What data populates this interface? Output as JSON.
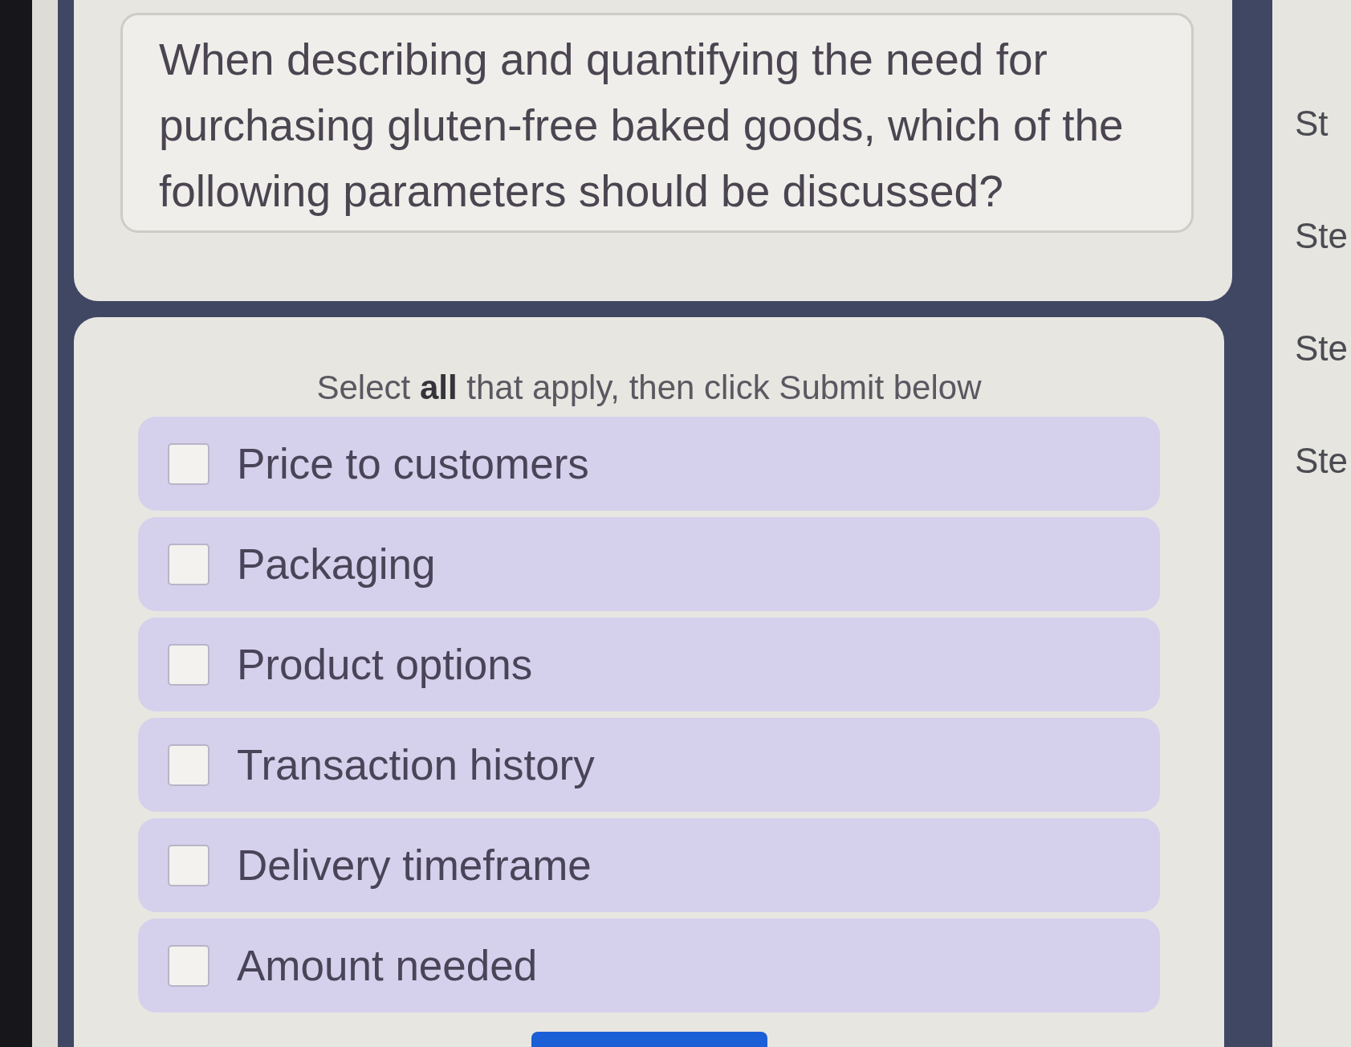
{
  "question": {
    "text": "When describing and quantifying the need for purchasing gluten-free baked goods, which of the following parameters should be discussed?"
  },
  "instructions": "Select **all** that apply, then click Submit below",
  "options": [
    {
      "label": "Price to customers",
      "checked": false
    },
    {
      "label": "Packaging",
      "checked": false
    },
    {
      "label": "Product options",
      "checked": false
    },
    {
      "label": "Transaction history",
      "checked": false
    },
    {
      "label": "Delivery timeframe",
      "checked": false
    },
    {
      "label": "Amount needed",
      "checked": false
    }
  ],
  "sidebar": {
    "steps": [
      "St",
      "Ste",
      "Ste",
      "Ste"
    ]
  }
}
